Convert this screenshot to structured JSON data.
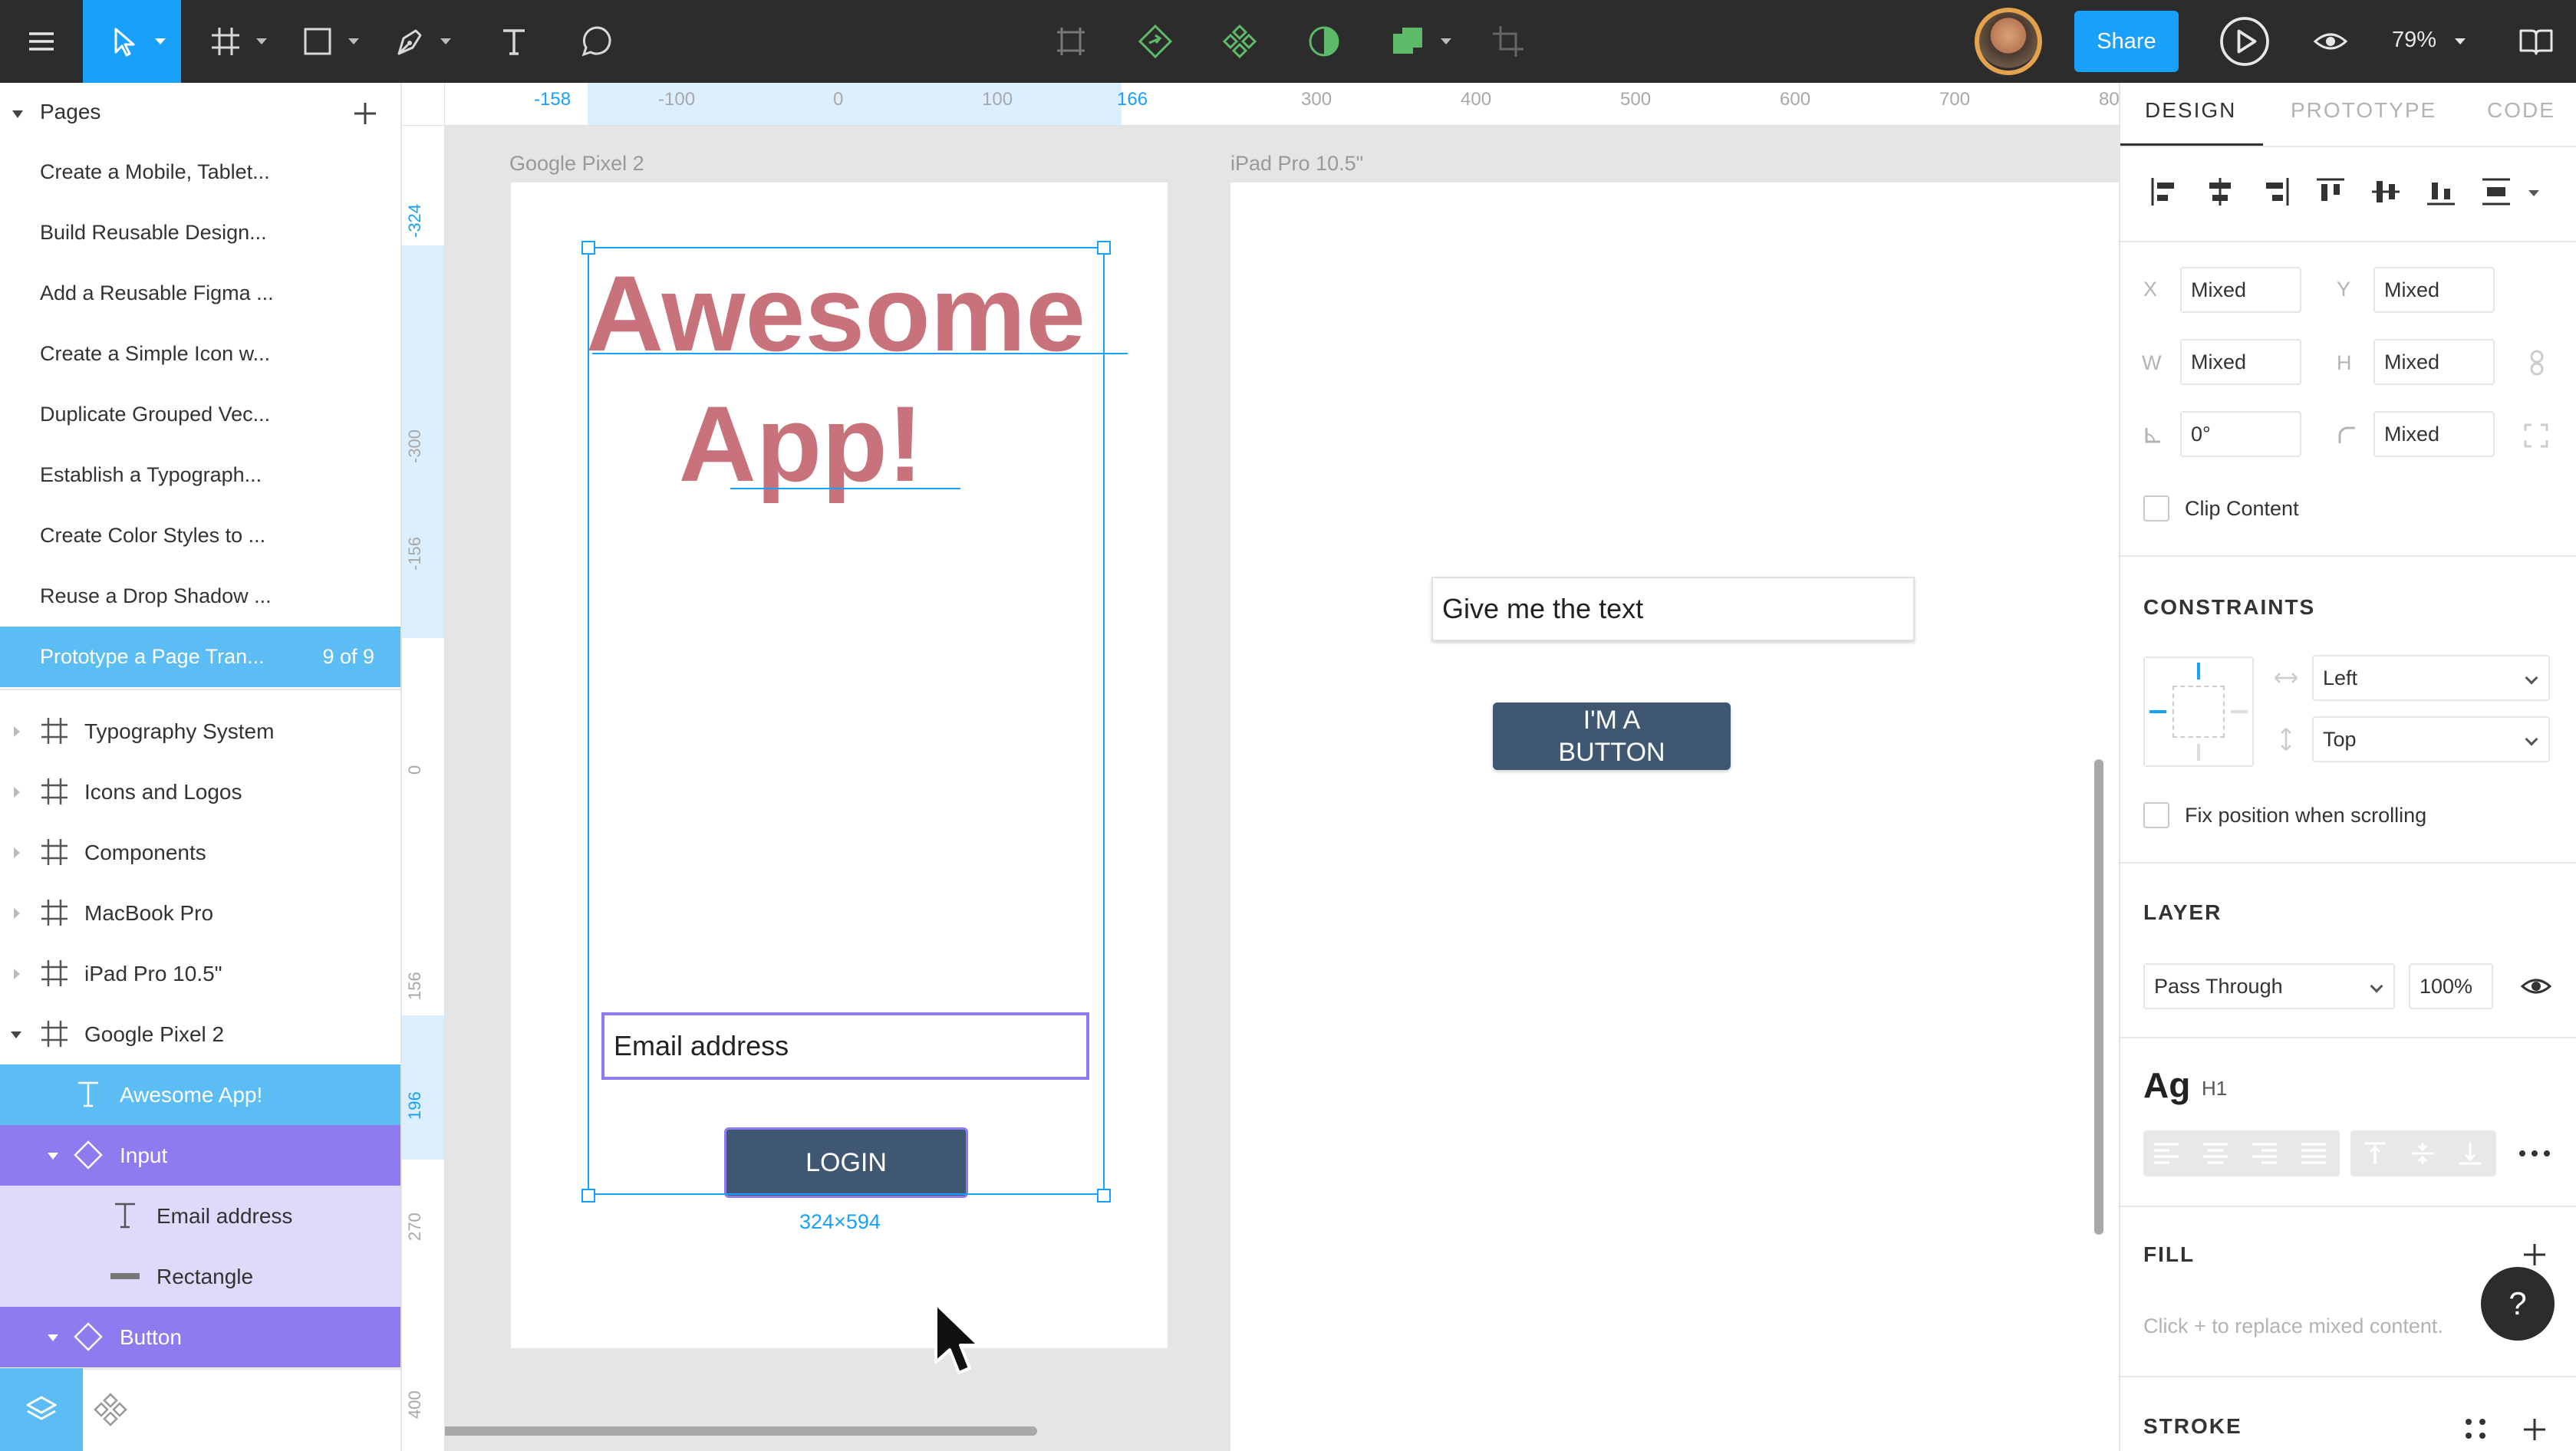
{
  "toolbar": {
    "share_label": "Share",
    "zoom_label": "79%"
  },
  "pages": {
    "header": "Pages",
    "items": [
      "Create a Mobile, Tablet...",
      "Build Reusable Design...",
      "Add a Reusable Figma ...",
      "Create a Simple Icon w...",
      "Duplicate Grouped Vec...",
      "Establish a Typograph...",
      "Create Color Styles to ...",
      "Reuse a Drop Shadow ...",
      "Prototype a Page Tran..."
    ],
    "active_count": "9 of 9"
  },
  "layers": {
    "frames": [
      "Typography System",
      "Icons and Logos",
      "Components",
      "MacBook Pro",
      "iPad Pro 10.5\"",
      "Google Pixel 2"
    ],
    "children": [
      "Awesome App!",
      "Input",
      "Email address",
      "Rectangle",
      "Button"
    ]
  },
  "ruler_top": [
    "-158",
    "-100",
    "0",
    "100",
    "166",
    "300",
    "400",
    "500",
    "600",
    "700",
    "80"
  ],
  "ruler_left": [
    "-324",
    "-300",
    "-156",
    "0",
    "156",
    "196",
    "270",
    "400"
  ],
  "canvas": {
    "frame1_label": "Google Pixel 2",
    "frame2_label": "iPad Pro 10.5\"",
    "app_title_line1": "Awesome",
    "app_title_line2": "App!",
    "email_text": "Email address",
    "login_label": "LOGIN",
    "size_label": "324×594",
    "text_input": "Give me the text",
    "button_line1": "I'M A",
    "button_line2": "BUTTON"
  },
  "right": {
    "tabs": [
      "DESIGN",
      "PROTOTYPE",
      "CODE"
    ],
    "x_label": "X",
    "x_value": "Mixed",
    "y_label": "Y",
    "y_value": "Mixed",
    "w_label": "W",
    "w_value": "Mixed",
    "h_label": "H",
    "h_value": "Mixed",
    "rotation_value": "0°",
    "radius_value": "Mixed",
    "clip_content": "Clip Content",
    "constraints_title": "CONSTRAINTS",
    "constraint_h": "Left",
    "constraint_v": "Top",
    "fix_position": "Fix position when scrolling",
    "layer_title": "LAYER",
    "blend_mode": "Pass Through",
    "opacity": "100%",
    "text_style_sample": "Ag",
    "text_style_name": "H1",
    "fill_title": "FILL",
    "fill_note": "Click + to replace mixed content.",
    "stroke_title": "STROKE"
  },
  "colors": {
    "accent": "#18a0fb",
    "title": "#c8727c",
    "button": "#3f5770",
    "selection": "#7b61ff",
    "toolbar": "#2c2c2c"
  },
  "help_label": "?"
}
